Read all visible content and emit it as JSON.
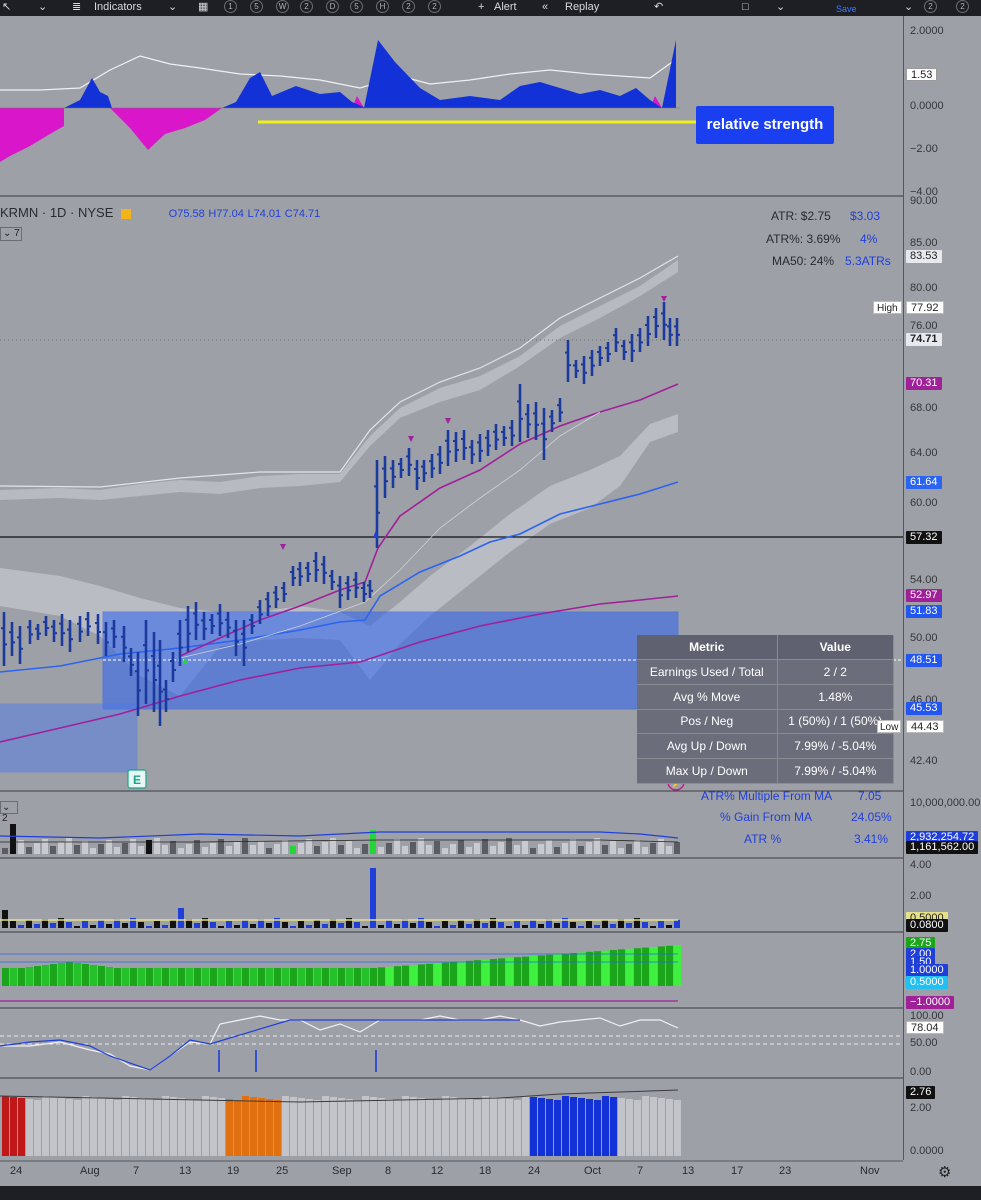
{
  "toolbar": {
    "indicators_label": "Indicators",
    "alert_label": "Alert",
    "replay_label": "Replay",
    "save_label": "Save",
    "interval_buttons": [
      "1",
      "5",
      "W",
      "2",
      "D",
      "5",
      "H",
      "2",
      "2"
    ],
    "right_counters": [
      "2",
      "2"
    ]
  },
  "callout": {
    "text": "relative strength"
  },
  "main_legend": {
    "symbol": "KRMN · 1D · NYSE",
    "open": "O75.58",
    "high": "H77.04",
    "low": "L74.01",
    "close": "C74.71",
    "collapse_count": "7"
  },
  "stats": {
    "atr_label": "ATR: $2.75",
    "atr_value": "$3.03",
    "atrpct_label": "ATR%: 3.69%",
    "atrpct_value": "4%",
    "ma50_label": "MA50: 24%",
    "ma50_value": "5.3ATRs"
  },
  "metrics_table": {
    "headers": [
      "Metric",
      "Value"
    ],
    "rows": [
      [
        "Earnings Used / Total",
        "2 / 2"
      ],
      [
        "Avg % Move",
        "1.48%"
      ],
      [
        "Pos / Neg",
        "1 (50%) / 1 (50%)"
      ],
      [
        "Avg Up / Down",
        "7.99% / -5.04%"
      ],
      [
        "Max Up / Down",
        "7.99% / -5.04%"
      ]
    ]
  },
  "extra_metrics": [
    {
      "label": "ATR% Multiple From MA",
      "value": "7.05"
    },
    {
      "label": "% Gain From MA",
      "value": "24.05%"
    },
    {
      "label": "ATR %",
      "value": "3.41%"
    }
  ],
  "earnings_marker": "E",
  "volume_legend_count": "2",
  "rs_scale": {
    "ticks": [
      "2.0000",
      "0.0000",
      "−2.00",
      "−4.00"
    ],
    "badge": "1.53"
  },
  "price_scale": {
    "ticks": [
      "90.00",
      "85.00",
      "80.00",
      "76.00",
      "68.00",
      "64.00",
      "60.00",
      "54.00",
      "50.00",
      "46.00",
      "42.40"
    ],
    "badges": {
      "ma_upper": "83.53",
      "high_label": "High",
      "high_value": "77.92",
      "last": "74.71",
      "ma_purple": "70.31",
      "ma_blue": "61.64",
      "hline": "57.32",
      "ma_purple_long": "52.97",
      "box_top": "51.83",
      "mid": "48.51",
      "box_bottom": "45.53",
      "low_label": "Low",
      "low_value": "44.43"
    }
  },
  "volume_scale": {
    "tick": "10,000,000.00",
    "badge1": "2,932,254.72",
    "badge2": "1,161,562.00"
  },
  "ind2_scale": {
    "ticks": [
      "4.00",
      "2.00"
    ],
    "badge1": "0.5000",
    "badge2": "0.0800"
  },
  "ind3_scale": {
    "badge_green": "2.75",
    "badge_blue1": "2.00",
    "badge_blue2": "1.50",
    "badge_blue3": "1.0000",
    "badge_blue4": "0.5000",
    "badge_purple": "−1.0000"
  },
  "ind4_scale": {
    "ticks": [
      "100.00",
      "50.00",
      "0.00"
    ],
    "badge": "78.04"
  },
  "ind5_scale": {
    "ticks": [
      "2.00",
      "0.0000"
    ],
    "badge": "2.76"
  },
  "x_axis": [
    "24",
    "Aug",
    "7",
    "13",
    "19",
    "25",
    "Sep",
    "8",
    "12",
    "18",
    "24",
    "Oct",
    "7",
    "13",
    "17",
    "23",
    "Nov"
  ],
  "colors": {
    "accent_blue": "#1a3ff0",
    "bar_navy": "#1f3a9c",
    "ma_purple": "#a0209a",
    "ma_blue": "#2a64f0",
    "green": "#1aa51a"
  },
  "chart_data": {
    "type": "bar",
    "title": "",
    "ohlc_last": {
      "open": 75.58,
      "high": 77.04,
      "low": 74.01,
      "close": 74.71
    },
    "price_ylim": [
      42.4,
      90.0
    ]
  }
}
